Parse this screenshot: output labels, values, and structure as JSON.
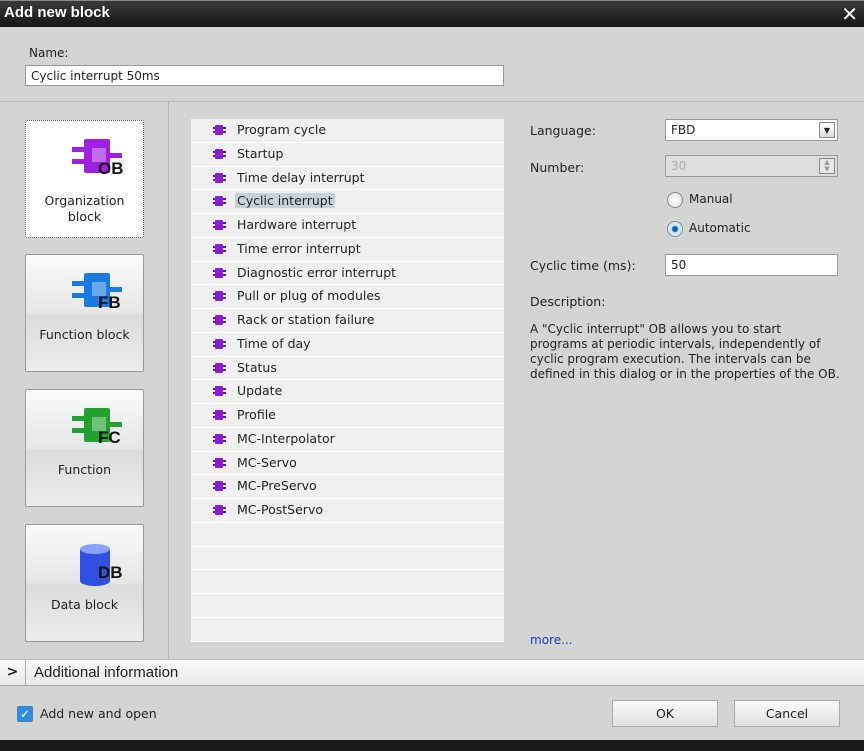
{
  "dialog": {
    "title": "Add new block",
    "close_icon": "close-icon"
  },
  "name": {
    "label": "Name:",
    "value": "Cyclic interrupt 50ms"
  },
  "block_types": [
    {
      "code": "OB",
      "label": "Organization block",
      "color": "#a020e0",
      "selected": true
    },
    {
      "code": "FB",
      "label": "Function block",
      "color": "#1a7ae0",
      "selected": false
    },
    {
      "code": "FC",
      "label": "Function",
      "color": "#22a030",
      "selected": false
    },
    {
      "code": "DB",
      "label": "Data block",
      "color": "#3050e0",
      "selected": false
    }
  ],
  "ob_list": {
    "selected": "Cyclic interrupt",
    "items": [
      "Program cycle",
      "Startup",
      "Time delay interrupt",
      "Cyclic interrupt",
      "Hardware interrupt",
      "Time error interrupt",
      "Diagnostic error interrupt",
      "Pull or plug of modules",
      "Rack or station failure",
      "Time of day",
      "Status",
      "Update",
      "Profile",
      "MC-Interpolator",
      "MC-Servo",
      "MC-PreServo",
      "MC-PostServo"
    ]
  },
  "properties": {
    "language_label": "Language:",
    "language_value": "FBD",
    "number_label": "Number:",
    "number_value": "30",
    "manual_label": "Manual",
    "automatic_label": "Automatic",
    "number_mode": "Automatic",
    "cyclic_time_label": "Cyclic time (ms):",
    "cyclic_time_value": "50",
    "description_label": "Description:",
    "description_text": "A \"Cyclic interrupt\" OB allows you to start programs at periodic intervals, independently of cyclic program execution. The intervals can be defined in this dialog or in the properties of the OB.",
    "more_link": "more..."
  },
  "additional_info": {
    "label": "Additional  information"
  },
  "footer": {
    "add_new_and_open_label": "Add new and open",
    "add_new_and_open_checked": true,
    "ok_label": "OK",
    "cancel_label": "Cancel"
  }
}
